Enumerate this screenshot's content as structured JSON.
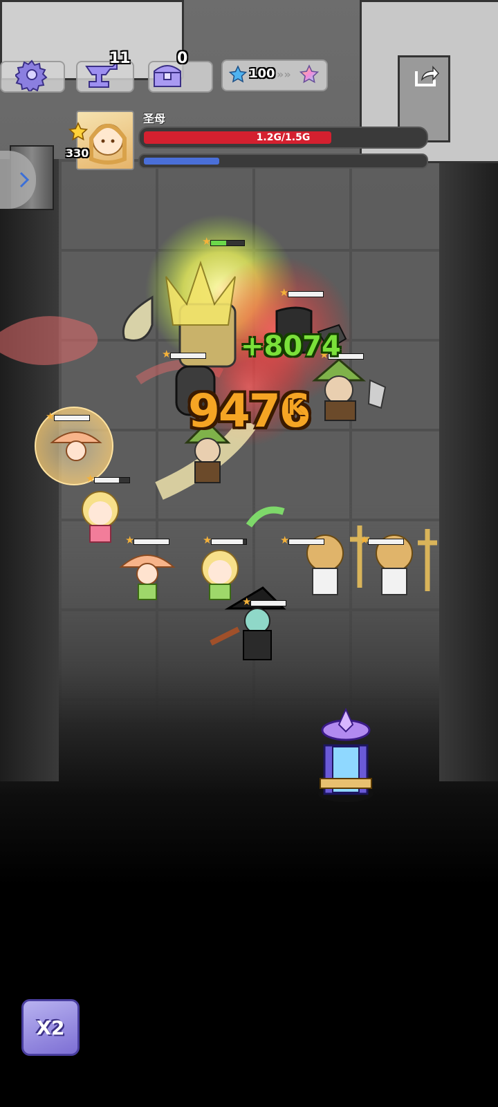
{
  "hud": {
    "settings_icon": "gear-icon",
    "forge": {
      "icon": "anvil-icon",
      "count": "11"
    },
    "chest": {
      "icon": "treasure-chest-icon",
      "count": "0"
    },
    "star_progress": {
      "current_stars": "100",
      "from_icon": "blue-star-icon",
      "to_icon": "rainbow-star-icon"
    },
    "share_icon": "share-icon"
  },
  "boss": {
    "name": "圣母",
    "level": "330",
    "hp_text": "1.2G/1.5G",
    "hp_fraction": 0.8,
    "energy_fraction": 0.27,
    "colors": {
      "hp": "#d4202f",
      "energy": "#4a6fd8"
    }
  },
  "combat": {
    "damage_number": "9476",
    "damage_suffix": "K",
    "heal_number": "+8074"
  },
  "controls": {
    "speed_button": "X2",
    "side_panel_icon": "chevron-right-icon"
  },
  "units": [
    {
      "id": "boss-knight",
      "hp": 0.45
    },
    {
      "id": "enemy-dark-armor",
      "hp": 1.0
    },
    {
      "id": "enemy-goblin-left",
      "hp": 1.0
    },
    {
      "id": "enemy-goblin-right",
      "hp": 1.0
    },
    {
      "id": "ally-mushroom-bubble",
      "hp": 1.0
    },
    {
      "id": "ally-blonde-girl",
      "hp": 0.7
    },
    {
      "id": "ally-mushroom-girl",
      "hp": 1.0
    },
    {
      "id": "ally-blonde-girl-2",
      "hp": 0.9
    },
    {
      "id": "ally-priest-left",
      "hp": 1.0
    },
    {
      "id": "ally-priest-right",
      "hp": 1.0
    },
    {
      "id": "ally-witch",
      "hp": 1.0
    }
  ]
}
